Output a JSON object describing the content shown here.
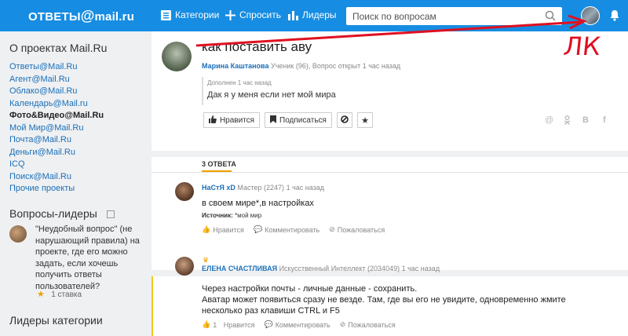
{
  "header": {
    "logo_text": "ОТВЕТЫ",
    "logo_at": "@",
    "logo_domain": "mail.ru",
    "nav": {
      "categories": "Категории",
      "ask": "Спросить",
      "leaders": "Лидеры"
    },
    "search_placeholder": "Поиск по вопросам",
    "accent_color": "#168de2"
  },
  "sidebar": {
    "projects_title": "О проектах Mail.Ru",
    "projects": [
      "Ответы@Mail.Ru",
      "Агент@Mail.Ru",
      "Облако@Mail.Ru",
      "Календарь@Mail.ru",
      "Фото&Видео@Mail.Ru",
      "Мой Мир@Mail.Ru",
      "Почта@Mail.Ru",
      "Деньги@Mail.Ru",
      "ICQ",
      "Поиск@Mail.Ru",
      "Прочие проекты"
    ],
    "leaders_title": "Вопросы-лидеры",
    "leader_question": "\"Неудобный вопрос\" (не нарушающий правила) на проекте, где его можно задать, если хочешь получить ответы пользователей?",
    "leader_bet": "1 ставка",
    "category_leaders_title": "Лидеры категории"
  },
  "question": {
    "title": "как поставить аву",
    "author": "Марина Каштанова",
    "meta": "Ученик (96), Вопрос открыт 1 час назад",
    "addendum_header": "Дополнен 1 час назад",
    "addendum_text": "Дак я у меня если нет мой мира",
    "like_label": "Нравится",
    "subscribe_label": "Подписаться"
  },
  "answers_tab": "3 ОТВЕТА",
  "answers": [
    {
      "user": "НаСтЯ xD",
      "rank": "Мастер (2247)",
      "time": "1 час назад",
      "text": "в своем мире*,в настройках",
      "source_label": "Источник:",
      "source_text": "*мой мир",
      "like": "Нравится",
      "comment": "Комментировать",
      "complain": "Пожаловаться"
    },
    {
      "user": "ЕЛЕНА СЧАСТЛИВАЯ",
      "rank": "Искусственный Интеллект (2034049)",
      "time": "1 час назад",
      "line1": "Через настройки почты - личные данные - сохранить.",
      "line2": "Аватар может появиться сразу не везде. Там, где вы его не увидите, одновременно жмите",
      "line3": "несколько раз клавиши CTRL и F5",
      "like_count": "1",
      "like": "Нравится",
      "comment": "Комментировать",
      "complain": "Пожаловаться"
    }
  ],
  "annotation": {
    "text": "ЛК",
    "color": "#e01020"
  }
}
